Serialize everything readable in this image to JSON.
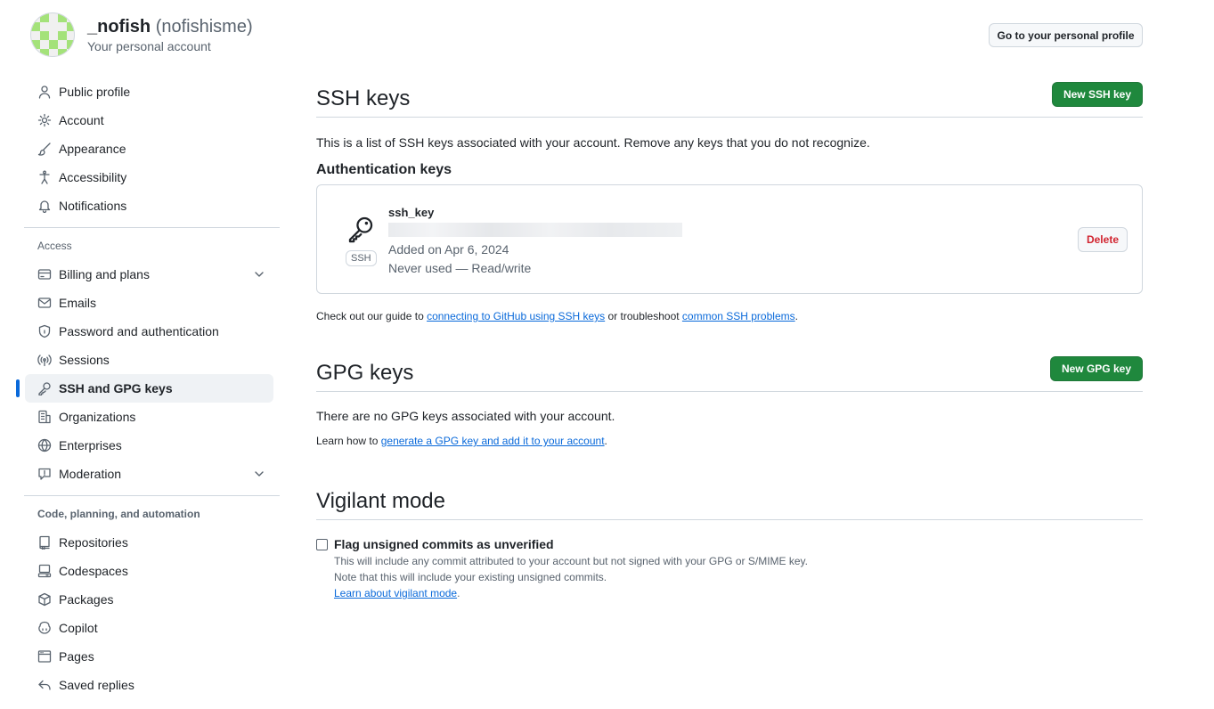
{
  "header": {
    "display_name": "_nofish",
    "login": "(nofishisme)",
    "subtitle": "Your personal account",
    "profile_button": "Go to your personal profile"
  },
  "sidebar": {
    "items_top": [
      {
        "label": "Public profile",
        "icon": "person-icon"
      },
      {
        "label": "Account",
        "icon": "gear-icon"
      },
      {
        "label": "Appearance",
        "icon": "paintbrush-icon"
      },
      {
        "label": "Accessibility",
        "icon": "accessibility-icon"
      },
      {
        "label": "Notifications",
        "icon": "bell-icon"
      }
    ],
    "access_heading": "Access",
    "items_access": [
      {
        "label": "Billing and plans",
        "icon": "credit-card-icon"
      },
      {
        "label": "Emails",
        "icon": "mail-icon"
      },
      {
        "label": "Password and authentication",
        "icon": "shield-lock-icon"
      },
      {
        "label": "Sessions",
        "icon": "broadcast-icon"
      },
      {
        "label": "SSH and GPG keys",
        "icon": "key-icon"
      },
      {
        "label": "Organizations",
        "icon": "organization-icon"
      },
      {
        "label": "Enterprises",
        "icon": "globe-icon"
      },
      {
        "label": "Moderation",
        "icon": "report-icon"
      }
    ],
    "code_heading": "Code, planning, and automation",
    "items_code": [
      {
        "label": "Repositories",
        "icon": "repo-icon"
      },
      {
        "label": "Codespaces",
        "icon": "codespaces-icon"
      },
      {
        "label": "Packages",
        "icon": "package-icon"
      },
      {
        "label": "Copilot",
        "icon": "copilot-icon"
      },
      {
        "label": "Pages",
        "icon": "browser-icon"
      },
      {
        "label": "Saved replies",
        "icon": "reply-icon"
      }
    ],
    "active_item": "SSH and GPG keys"
  },
  "ssh": {
    "title": "SSH keys",
    "new_button": "New SSH key",
    "description": "This is a list of SSH keys associated with your account. Remove any keys that you do not recognize.",
    "auth_heading": "Authentication keys",
    "key": {
      "name": "ssh_key",
      "type_label": "SSH",
      "added": "Added on Apr 6, 2024",
      "usage": "Never used — Read/write",
      "delete_button": "Delete"
    },
    "guide_prefix": "Check out our guide to ",
    "guide_link": "connecting to GitHub using SSH keys",
    "guide_middle": " or troubleshoot ",
    "guide_link2": "common SSH problems",
    "guide_suffix": "."
  },
  "gpg": {
    "title": "GPG keys",
    "new_button": "New GPG key",
    "empty": "There are no GPG keys associated with your account.",
    "learn_prefix": "Learn how to ",
    "learn_link": "generate a GPG key and add it to your account",
    "learn_suffix": "."
  },
  "vigilant": {
    "title": "Vigilant mode",
    "checkbox_label": "Flag unsigned commits as unverified",
    "checked": false,
    "note1": "This will include any commit attributed to your account but not signed with your GPG or S/MIME key.",
    "note2": "Note that this will include your existing unsigned commits.",
    "learn_link": "Learn about vigilant mode",
    "learn_suffix": "."
  },
  "colors": {
    "accent": "#0969da",
    "primary_button": "#1f883d",
    "danger": "#d1242f",
    "avatar_green": "#a4e27a"
  }
}
